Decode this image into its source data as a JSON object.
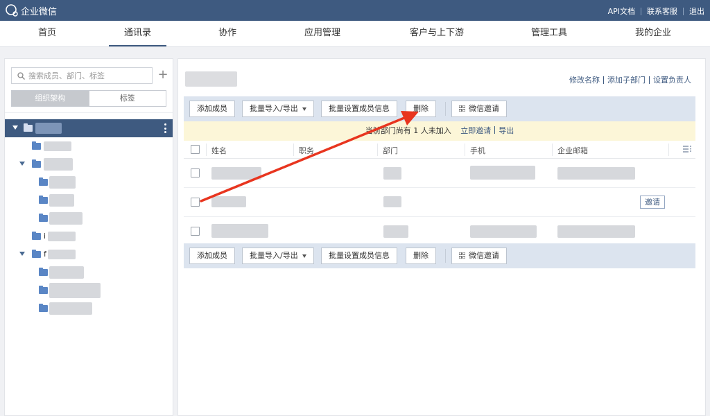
{
  "app": {
    "title": "企业微信"
  },
  "top_links": [
    "API文档",
    "联系客服",
    "退出"
  ],
  "nav": [
    {
      "label": "首页",
      "active": false
    },
    {
      "label": "通讯录",
      "active": true
    },
    {
      "label": "协作",
      "active": false
    },
    {
      "label": "应用管理",
      "active": false
    },
    {
      "label": "客户与上下游",
      "active": false
    },
    {
      "label": "管理工具",
      "active": false
    },
    {
      "label": "我的企业",
      "active": false
    }
  ],
  "sidebar": {
    "search_placeholder": "搜索成员、部门、标签",
    "add_label": "+",
    "tabs": [
      {
        "label": "组织架构",
        "active": true
      },
      {
        "label": "标签",
        "active": false
      }
    ],
    "tree_chars": [
      "i",
      "i",
      "f"
    ]
  },
  "main": {
    "header_links": [
      "修改名称",
      "添加子部门",
      "设置负责人"
    ],
    "toolbar": {
      "add_member": "添加成员",
      "import_export": "批量导入/导出",
      "batch_set": "批量设置成员信息",
      "delete": "删除",
      "wechat_invite": "微信邀请"
    },
    "notice": {
      "text": "当前部门尚有 1 人未加入",
      "invite_now": "立即邀请",
      "export": "导出"
    },
    "columns": [
      "姓名",
      "职务",
      "部门",
      "手机",
      "企业邮箱"
    ],
    "row_action_invite": "邀请"
  },
  "colors": {
    "topbar": "#3e5a80",
    "annotation_arrow": "#e8351f",
    "notice_bg": "#fcf6d8"
  },
  "icons": [
    "chat-bubble-logo-icon",
    "search-icon",
    "folder-icon",
    "caret-down-icon",
    "grid-qr-icon",
    "column-settings-icon",
    "kebab-icon"
  ]
}
